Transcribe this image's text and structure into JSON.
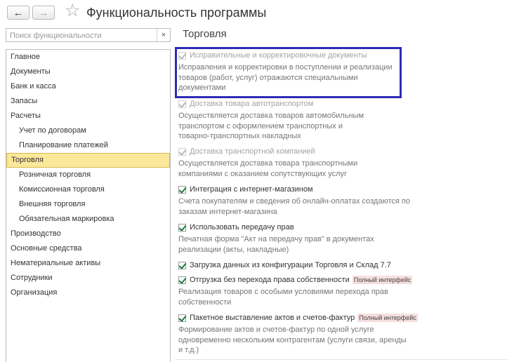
{
  "header": {
    "back_label": "←",
    "forward_label": "→",
    "star": "☆",
    "title": "Функциональность программы"
  },
  "search": {
    "placeholder": "Поиск функциональности",
    "value": "",
    "clear_label": "×"
  },
  "sidebar": {
    "items": [
      {
        "label": "Главное"
      },
      {
        "label": "Документы"
      },
      {
        "label": "Банк и касса"
      },
      {
        "label": "Запасы"
      },
      {
        "label": "Расчеты"
      },
      {
        "label": "Учет по договорам"
      },
      {
        "label": "Планирование платежей"
      },
      {
        "label": "Торговля"
      },
      {
        "label": "Розничная торговля"
      },
      {
        "label": "Комиссионная торговля"
      },
      {
        "label": "Внешняя торговля"
      },
      {
        "label": "Обязательная маркировка"
      },
      {
        "label": "Производство"
      },
      {
        "label": "Основные средства"
      },
      {
        "label": "Нематериальные активы"
      },
      {
        "label": "Сотрудники"
      },
      {
        "label": "Организация"
      }
    ]
  },
  "main": {
    "section_title": "Торговля",
    "features": [
      {
        "label": "Исправительные и корректировочные документы",
        "checked": true,
        "enabled": false,
        "desc": [
          "Исправления и корректировки в поступлении и реализации",
          "товаров (работ, услуг) отражаются специальными",
          "документами"
        ]
      },
      {
        "label": "Доставка товара автотранспортом",
        "checked": true,
        "enabled": false,
        "desc": [
          "Осуществляется доставка товаров автомобильным",
          "транспортом с оформлением транспортных и",
          "товарно-транспортных накладных"
        ]
      },
      {
        "label": "Доставка транспортной компанией",
        "checked": true,
        "enabled": false,
        "desc": [
          "Осуществляется доставка товара транспортными",
          "компаниями с оказанием сопутствующих услуг"
        ]
      },
      {
        "label": "Интеграция с интернет-магазином",
        "checked": true,
        "enabled": true,
        "desc": [
          "Счета покупателям и сведения об онлайн-оплатах создаются по",
          "заказам интернет-магазина"
        ]
      },
      {
        "label": "Использовать передачу прав",
        "checked": true,
        "enabled": true,
        "desc": [
          "Печатная форма \"Акт на передачу прав\" в документах",
          "реализации (акты, накладные)"
        ]
      },
      {
        "label": "Загрузка данных из конфигурации Торговля и Склад 7.7",
        "checked": true,
        "enabled": true,
        "desc": []
      },
      {
        "label": "Отгрузка без перехода права собственности",
        "checked": true,
        "enabled": true,
        "tag": "Полный интерфейс",
        "desc": [
          "Реализация товаров с особыми условиями перехода прав",
          "собственности"
        ]
      },
      {
        "label": "Пакетное выставление актов и счетов-фактур",
        "checked": true,
        "enabled": true,
        "tag": "Полный интерфейс",
        "desc": [
          "Формирование актов и счетов-фактур по одной услуге",
          "одновременно нескольким контрагентам (услуги связи, аренды",
          "и т.д.)"
        ]
      }
    ]
  },
  "colors": {
    "highlight_frame": "#2f2ab5",
    "active_item_bg": "#fce89a",
    "active_item_border": "#d9b745",
    "checkmark": "#1a7a3d",
    "tag_bg": "#f6dede"
  }
}
